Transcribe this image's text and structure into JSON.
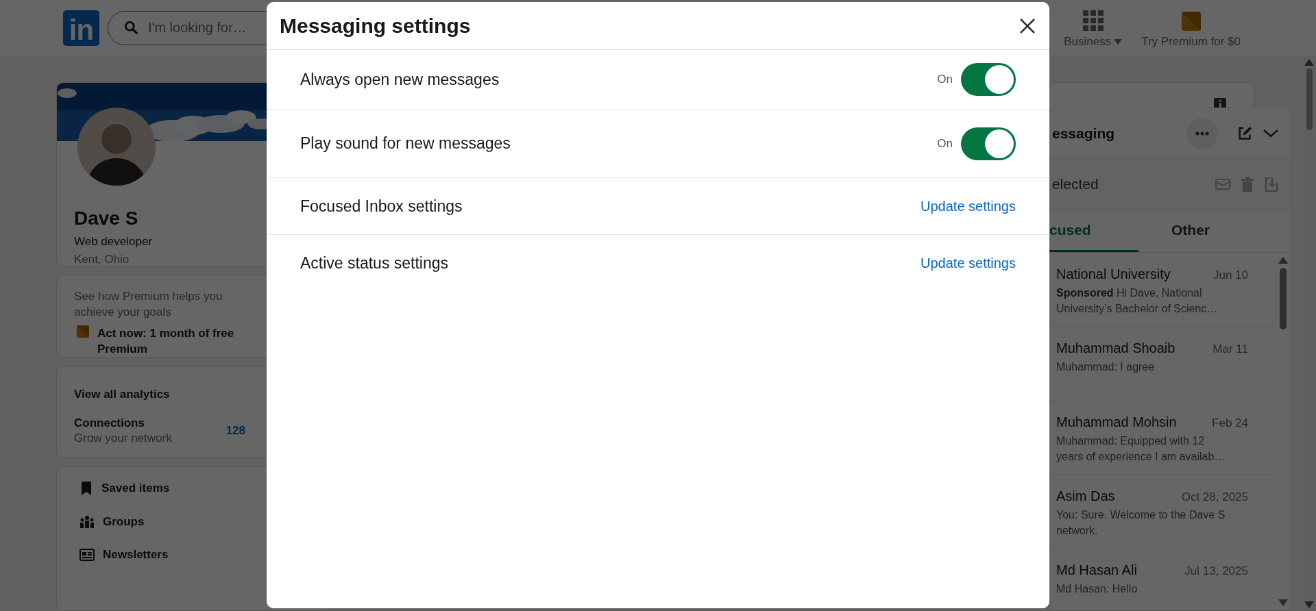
{
  "nav": {
    "logo": "in",
    "search": {
      "placeholder": "I'm looking for…"
    },
    "items": [
      {
        "kind": "business",
        "label": "Business"
      },
      {
        "kind": "premium",
        "label": "Try Premium for $0"
      }
    ]
  },
  "profile": {
    "name": "Dave S",
    "headline": "Web developer",
    "location": "Kent, Ohio"
  },
  "premium_card": {
    "text": "See how Premium helps you achieve your goals",
    "offer": "Act now: 1 month of free Premium"
  },
  "analytics": {
    "link": "View all analytics",
    "stat_label": "Connections",
    "stat_sub": "Grow your network",
    "stat_value": "128"
  },
  "shortcuts": [
    {
      "kind": "bookmark",
      "label": "Saved items"
    },
    {
      "kind": "groups",
      "label": "Groups"
    },
    {
      "kind": "newsletter",
      "label": "Newsletters"
    }
  ],
  "messaging": {
    "title": "essaging",
    "selection_label": "elected",
    "tabs": [
      {
        "label": "cused",
        "selected": true
      },
      {
        "label": "Other",
        "selected": false
      }
    ],
    "conversations": [
      {
        "name": "National University",
        "date": "Jun 10",
        "preview": "**Sponsored**  Hi Dave, National University’s Bachelor of Scienc…"
      },
      {
        "name": "Muhammad Shoaib",
        "date": "Mar 11",
        "preview": "Muhammad: I agree"
      },
      {
        "name": "Muhammad Mohsin",
        "date": "Feb 24",
        "preview": "Muhammad: Equipped with 12 years of experience I am availab…"
      },
      {
        "name": "Asim Das",
        "date": "Oct 28, 2025",
        "preview": "You: Sure. Welcome to the Dave S network."
      },
      {
        "name": "Md Hasan Ali",
        "date": "Jul 13, 2025",
        "preview": "Md Hasan: Hello"
      }
    ]
  },
  "dialog": {
    "title": "Messaging settings",
    "settings": [
      {
        "kind": "toggle",
        "label": "Always open new messages",
        "state_label": "On",
        "on": true
      },
      {
        "kind": "toggle",
        "label": "Play sound for new messages",
        "state_label": "On",
        "on": true
      },
      {
        "kind": "link",
        "label": "Focused Inbox settings",
        "action": "Update settings"
      },
      {
        "kind": "link",
        "label": "Active status settings",
        "action": "Update settings"
      }
    ]
  }
}
